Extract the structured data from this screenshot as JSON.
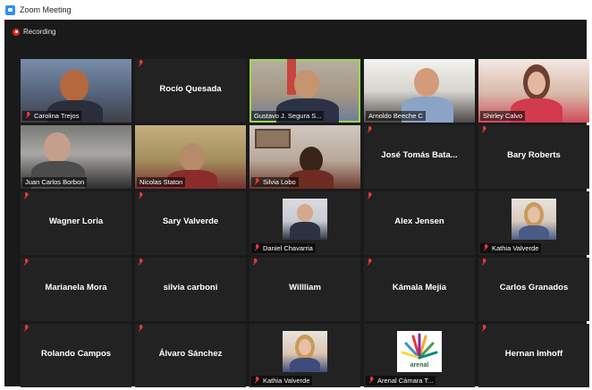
{
  "window": {
    "title": "Zoom Meeting"
  },
  "meeting": {
    "recording_label": "Recording"
  },
  "participants": [
    {
      "name": "Carolina Trejos",
      "kind": "video"
    },
    {
      "name": "Rocío Quesada",
      "kind": "name"
    },
    {
      "name": "Gustavo J. Segura S...",
      "kind": "video",
      "active_speaker": true
    },
    {
      "name": "Arnoldo Beeche C",
      "kind": "video"
    },
    {
      "name": "Shirley Calvo",
      "kind": "video"
    },
    {
      "name": "Juan Carlos Borbon",
      "kind": "video"
    },
    {
      "name": "Nicolas Staton",
      "kind": "video"
    },
    {
      "name": "Silvia Lobo",
      "kind": "video"
    },
    {
      "name": "José Tomás Bata...",
      "kind": "name"
    },
    {
      "name": "Bary Roberts",
      "kind": "name"
    },
    {
      "name": "Wagner Loria",
      "kind": "name"
    },
    {
      "name": "Sary Valverde",
      "kind": "name"
    },
    {
      "name": "Daniel Chavarria",
      "kind": "photo"
    },
    {
      "name": "Alex Jensen",
      "kind": "name"
    },
    {
      "name": "Kathia Valverde",
      "kind": "photo"
    },
    {
      "name": "Marianela Mora",
      "kind": "name"
    },
    {
      "name": "silvia carboni",
      "kind": "name"
    },
    {
      "name": "Willliam",
      "kind": "name"
    },
    {
      "name": "Kámala Mejía",
      "kind": "name"
    },
    {
      "name": "Carlos Granados",
      "kind": "name"
    },
    {
      "name": "Rolando Campos",
      "kind": "name"
    },
    {
      "name": "Álvaro Sánchez",
      "kind": "name"
    },
    {
      "name": "Kathia Valverde",
      "kind": "photo"
    },
    {
      "name": "Arenal Cámara T...",
      "kind": "logo",
      "logo_text": "arenal"
    },
    {
      "name": "Hernan Imhoff",
      "kind": "name"
    }
  ],
  "colors": {
    "meeting_bg": "#1a1a1a",
    "tile_bg": "#222222",
    "active_speaker_border": "#9bd84a",
    "muted_mic": "#e53935",
    "recording_dot": "#e02828"
  }
}
